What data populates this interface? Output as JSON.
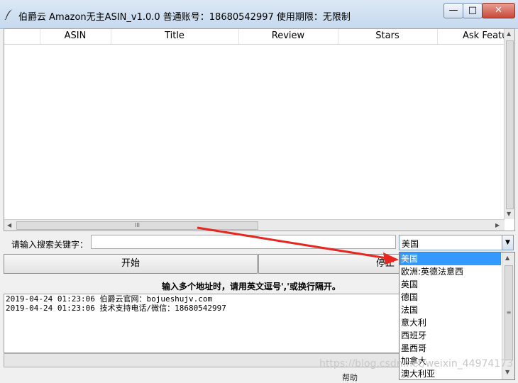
{
  "window": {
    "title": "伯爵云 Amazon无主ASIN_v1.0.0  普通账号：18680542997  使用期限：无限制",
    "controls": {
      "minimize": "—",
      "maximize": "□",
      "close": "✕"
    }
  },
  "table": {
    "columns": [
      "ASIN",
      "Title",
      "Review",
      "Stars",
      "Ask Featu"
    ],
    "rows": []
  },
  "search": {
    "label": "请输入搜索关键字：",
    "value": ""
  },
  "region_combo": {
    "selected": "美国"
  },
  "buttons": {
    "start": "开始",
    "stop": "停止"
  },
  "instruction": "输入多个地址时，请用英文逗号','或换行隔开。",
  "log": [
    "2019-04-24 01:23:06 伯爵云官网：bojueshujv.com",
    "2019-04-24 01:23:06 技术支持电话/微信：18680542997"
  ],
  "dropdown": {
    "options": [
      "美国",
      "欧洲:英德法意西",
      "英国",
      "德国",
      "法国",
      "意大利",
      "西班牙",
      "墨西哥",
      "加拿大",
      "澳大利亚"
    ],
    "highlighted": "美国"
  },
  "partial_menu_text": "帮助",
  "watermark": "https://blog.csdn.net/weixin_44974173",
  "colors": {
    "highlight": "#3399ff",
    "annotation_arrow": "#e8261e"
  },
  "icons": {
    "title": "feather-icon",
    "combo": "chevron-down-icon"
  }
}
